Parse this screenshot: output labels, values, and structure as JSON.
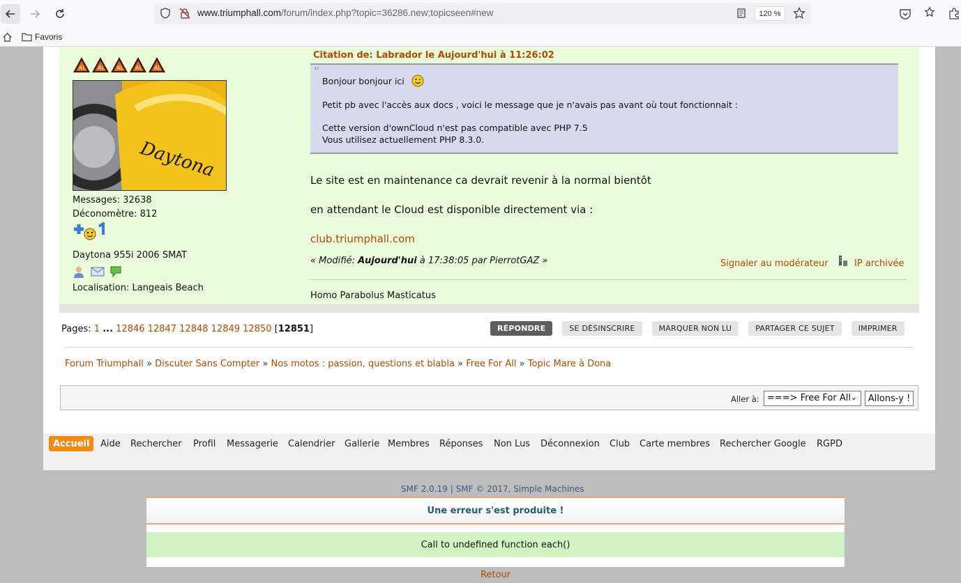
{
  "browser": {
    "url_host": "www.triumphall.com",
    "url_path": "/forum/index.php?topic=36286.new;topicseen#new",
    "zoom": "120 %",
    "bookmark_label": "Favoris"
  },
  "poster": {
    "ranks_count": 5,
    "messages": "Messages: 32638",
    "deconometre": "Déconomètre: 812",
    "bike": "Daytona 955i 2006 SMAT",
    "location": "Localisation: Langeais Beach"
  },
  "post": {
    "quote_header": "Citation de: Labrador le Aujourd'hui à 11:26:02",
    "quote_lines": [
      "Bonjour bonjour ici",
      "Petit pb avec l'accès aux docs , voici le message que je n'avais pas avant où tout fonctionnait :",
      "Cette version d'ownCloud n'est pas compatible avec PHP 7.5",
      "Vous utilisez actuellement PHP 8.3.0."
    ],
    "body_line1": "Le site est en maintenance ca devrait revenir à la normal bientôt",
    "body_line2": "en attendant le Cloud est disponible directement via :",
    "body_link": "club.triumphall.com",
    "modified_prefix": "« Modifié:",
    "modified_when": "Aujourd'hui",
    "modified_suffix": "à 17:38:05 par PierrotGAZ »",
    "report_label": "Signaler au modérateur",
    "ip_label": "IP archivée",
    "signature": "Homo Parabolus Masticatus"
  },
  "pagination": {
    "label": "Pages:",
    "first": "1",
    "ellipsis": "...",
    "pages": [
      "12846",
      "12847",
      "12848",
      "12849",
      "12850"
    ],
    "current": "12851"
  },
  "actions": [
    "RÉPONDRE",
    "SE DÉSINSCRIRE",
    "MARQUER NON LU",
    "PARTAGER CE SUJET",
    "IMPRIMER"
  ],
  "breadcrumb": [
    "Forum Triumphall",
    "Discuter Sans Compter",
    "Nos motos : passion, questions et blabla",
    "Free For All",
    "Topic Mare à Dona"
  ],
  "jump": {
    "label": "Aller à:",
    "selected": "===> Free For All",
    "go": "Allons-y !"
  },
  "footer_nav": [
    "Accueil",
    "Aide",
    "Rechercher",
    "Profil",
    "Messagerie",
    "Calendrier",
    "Gallerie",
    "Membres",
    "Réponses",
    "Non Lus",
    "Déconnexion",
    "Club",
    "Carte membres",
    "Rechercher Google",
    "RGPD"
  ],
  "smf": {
    "version": "SMF 2.0.19",
    "sep": "|",
    "copyright": "SMF © 2017,",
    "vendor": "Simple Machines"
  },
  "error": {
    "title": "Une erreur s'est produite !",
    "message": "Call to undefined function each()",
    "back": "Retour"
  },
  "colors": {
    "accent": "#f38a14",
    "link": "#b04a00",
    "post_bg": "#eafbdb",
    "quote_bg": "#d7daec"
  }
}
